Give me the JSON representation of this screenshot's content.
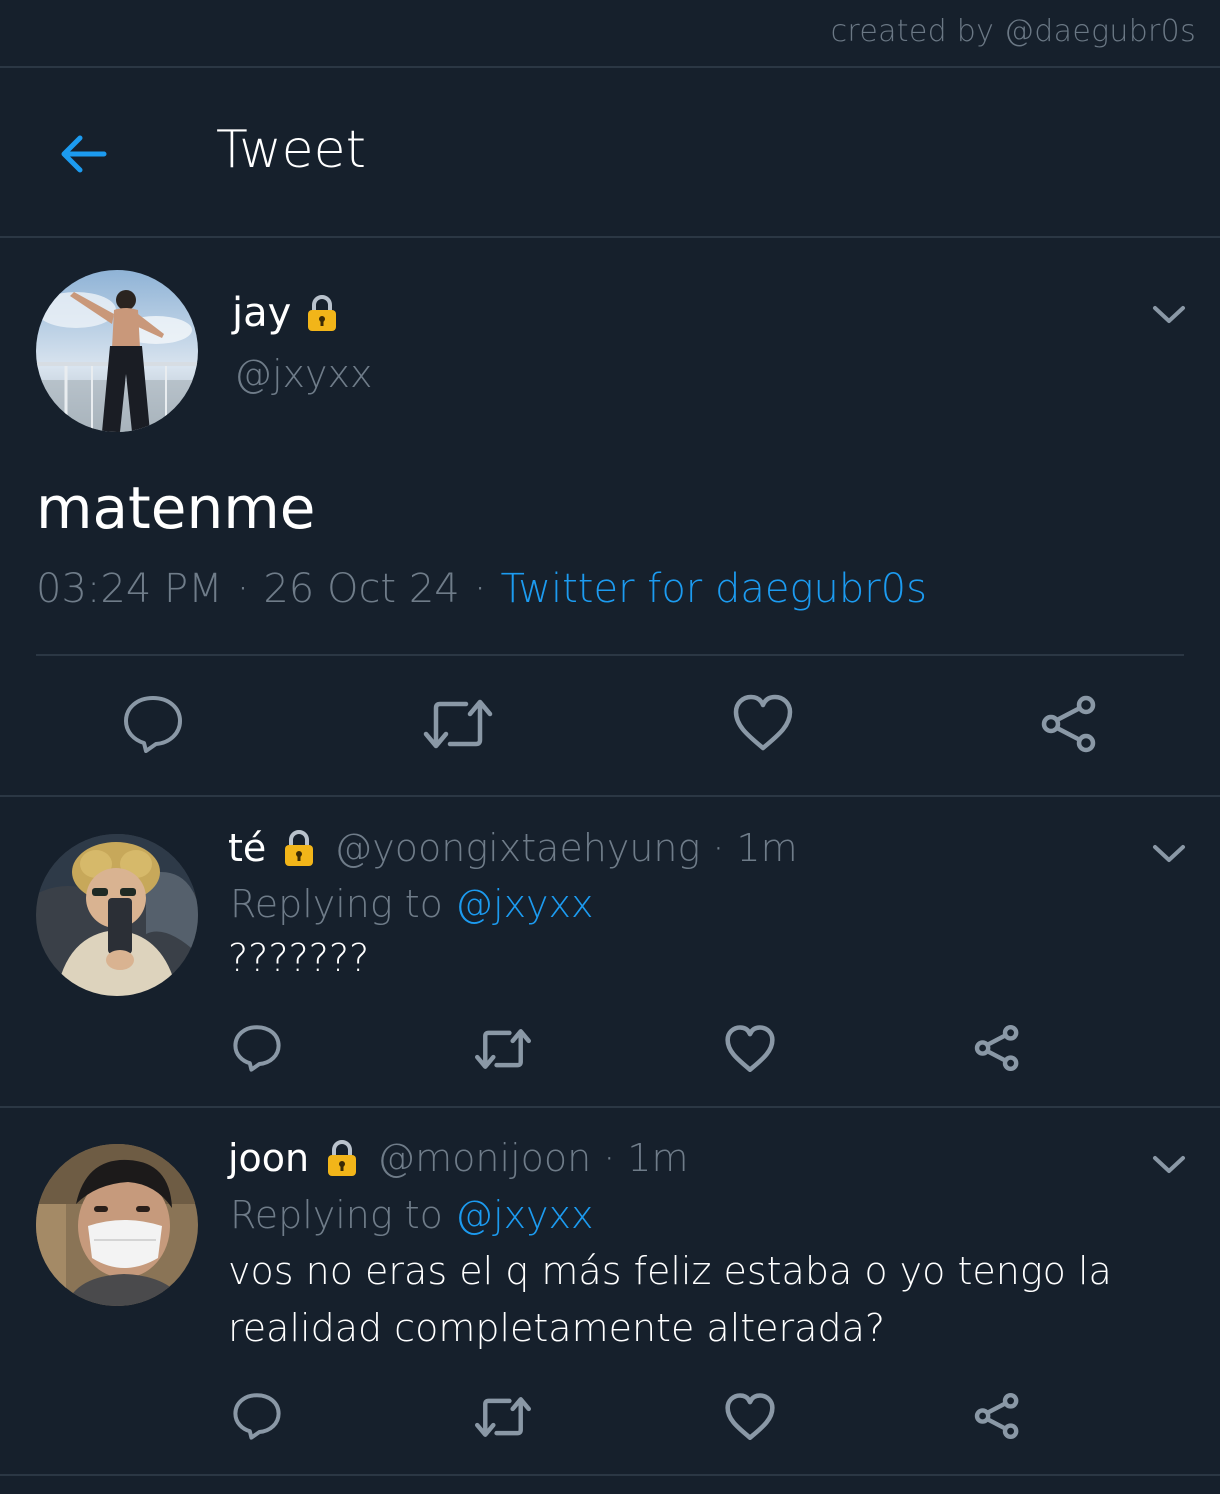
{
  "credit": "created by @daegubr0s",
  "header": {
    "title": "Tweet"
  },
  "main_tweet": {
    "name": "jay",
    "handle": "@jxyxx",
    "text": "matenme",
    "time": "03:24 PM",
    "date": "26 Oct 24",
    "source": "Twitter for daegubr0s"
  },
  "replies": [
    {
      "name": "té",
      "handle": "@yoongixtaehyung",
      "time": "1m",
      "replying_label": "Replying to",
      "replying_to": "@jxyxx",
      "text": "???????"
    },
    {
      "name": "joon",
      "handle": "@monijoon",
      "time": "1m",
      "replying_label": "Replying to",
      "replying_to": "@jxyxx",
      "text": "vos no eras el q más feliz estaba o yo tengo la realidad completamente alterada?"
    }
  ],
  "separators": {
    "dot": "·"
  },
  "colors": {
    "background": "#16202c",
    "accent": "#1c9bf0",
    "muted": "#6f7c89",
    "divider": "#2b3744",
    "icon": "#8a98a6",
    "lock": "#f2b519"
  },
  "icons": {
    "back": "arrow-left-icon",
    "lock": "lock-icon",
    "chevron": "chevron-down-icon",
    "reply": "comment-icon",
    "retweet": "retweet-icon",
    "like": "heart-icon",
    "share": "share-icon"
  }
}
